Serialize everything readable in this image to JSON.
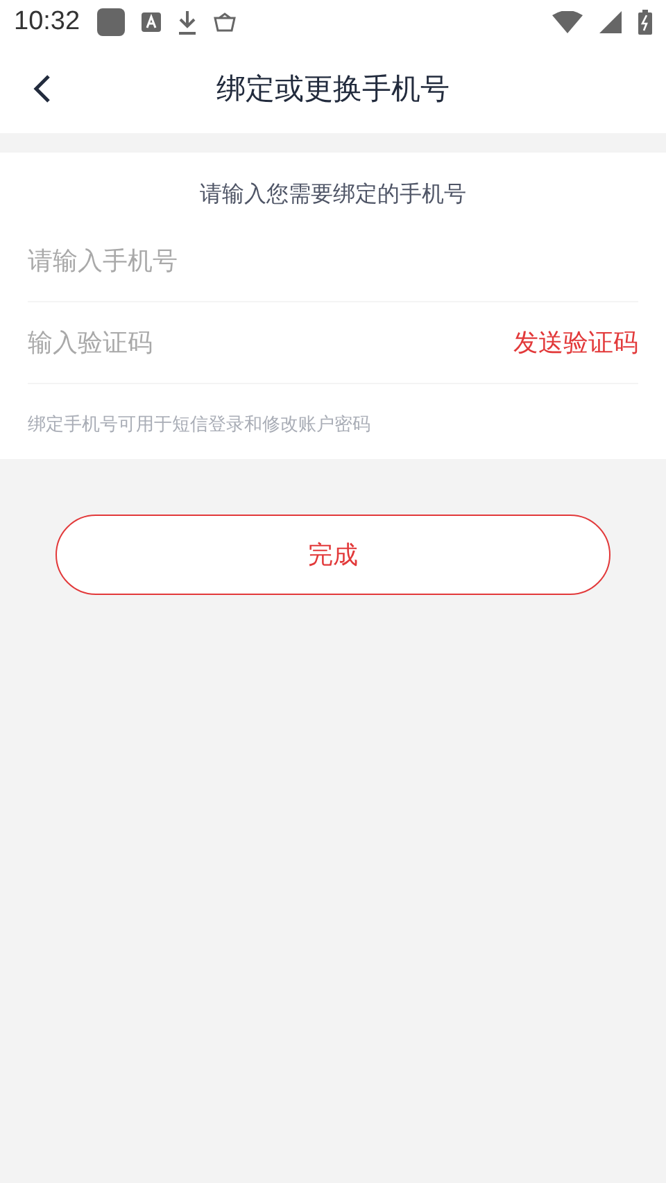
{
  "status_bar": {
    "time": "10:32"
  },
  "header": {
    "title": "绑定或更换手机号"
  },
  "form": {
    "prompt": "请输入您需要绑定的手机号",
    "phone_field": {
      "placeholder": "请输入手机号"
    },
    "code_field": {
      "placeholder": "输入验证码"
    },
    "send_code_button": "发送验证码",
    "hint": "绑定手机号可用于短信登录和修改账户密码"
  },
  "submit_button": "完成"
}
